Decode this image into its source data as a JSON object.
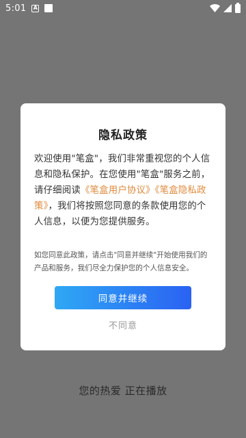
{
  "status_bar": {
    "time": "5:01",
    "icons": [
      "a-notification-icon",
      "square-notification-icon",
      "wifi-icon",
      "signal-icon",
      "battery-icon"
    ]
  },
  "background": {
    "footer_text": "您的热爱 正在播放"
  },
  "dialog": {
    "title": "隐私政策",
    "body_before": "欢迎使用\"笔盒\"，我们非常重视您的个人信息和隐私保护。在您使用\"笔盒\"服务之前，请仔细阅读",
    "link_user_agreement": "《笔盒用户协议》",
    "link_privacy_policy": "《笔盒隐私政策》",
    "body_after": "，我们将按照您同意的条款使用您的个人信息，以便为您提供服务。",
    "note": "如您同意此政策，请点击\"同意并继续\"开始使用我们的产品和服务，我们尽全力保护您的个人信息安全。",
    "agree_label": "同意并继续",
    "disagree_label": "不同意",
    "link_color": "#e08a3c",
    "button_gradient": [
      "#2fa8f4",
      "#2a62f3"
    ]
  }
}
